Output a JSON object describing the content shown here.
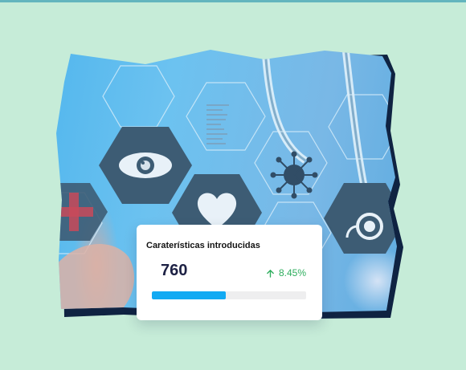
{
  "hero": {
    "image_description": "medical-hexagon-icons-photo",
    "icons": [
      "eye-icon",
      "heart-icon",
      "virus-icon",
      "stethoscope-icon"
    ]
  },
  "stat_card": {
    "title": "Caraterísticas introducidas",
    "value": "760",
    "change": "8.45%",
    "change_direction": "up",
    "progress_fraction": 0.48
  },
  "colors": {
    "background": "#c6ecd8",
    "card_value": "#1d2144",
    "positive": "#2fae5e",
    "progress": "#12aaf3",
    "hex_dark": "#3a5a72"
  }
}
